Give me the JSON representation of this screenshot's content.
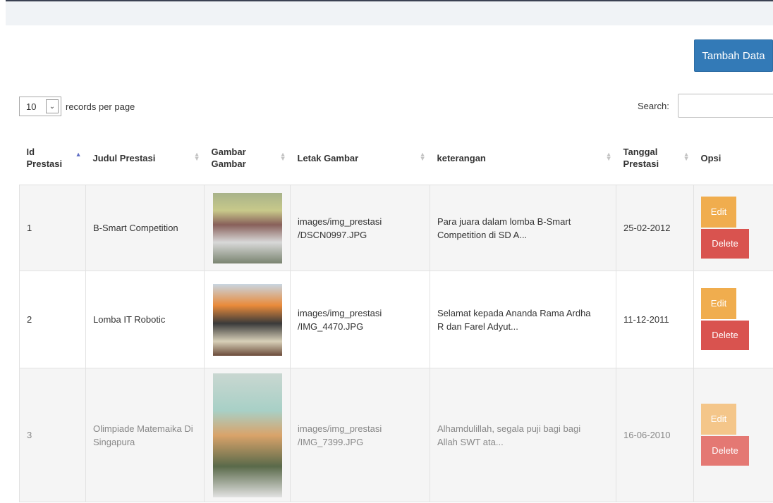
{
  "toolbar": {
    "add_label": "Tambah Data"
  },
  "length": {
    "value": "10",
    "suffix": "records per page"
  },
  "search": {
    "label": "Search:"
  },
  "table": {
    "headers": [
      "Id\nPrestasi",
      "Judul Prestasi",
      "Gambar\nGambar",
      "Letak Gambar",
      "keterangan",
      "Tanggal\nPrestasi",
      "Opsi"
    ],
    "rows": [
      {
        "id": "1",
        "judul": "B-Smart Competition",
        "letak": "images/img_prestasi\n/DSCN0997.JPG",
        "keterangan": "Para juara dalam lomba B-Smart\nCompetition di SD A...",
        "tanggal": "25-02-2012",
        "edit": "Edit",
        "delete": "Delete"
      },
      {
        "id": "2",
        "judul": "Lomba IT Robotic",
        "letak": "images/img_prestasi\n/IMG_4470.JPG",
        "keterangan": "Selamat kepada Ananda Rama Ardha\nR dan Farel Adyut...",
        "tanggal": "11-12-2011",
        "edit": "Edit",
        "delete": "Delete"
      },
      {
        "id": "3",
        "judul": "Olimpiade Matemaika Di\nSingapura",
        "letak": "images/img_prestasi\n/IMG_7399.JPG",
        "keterangan": "Alhamdulillah, segala puji bagi bagi\nAllah SWT ata...",
        "tanggal": "16-06-2010",
        "edit": "Edit",
        "delete": "Delete"
      }
    ]
  },
  "colors": {
    "primary": "#337ab7",
    "warning": "#f0ad4e",
    "danger": "#d9534f",
    "sort_active": "#5e6cc4"
  },
  "icons": {
    "sort": "sort-icon",
    "sort_asc": "sort-asc-icon",
    "dropdown": "chevron-down-icon"
  }
}
